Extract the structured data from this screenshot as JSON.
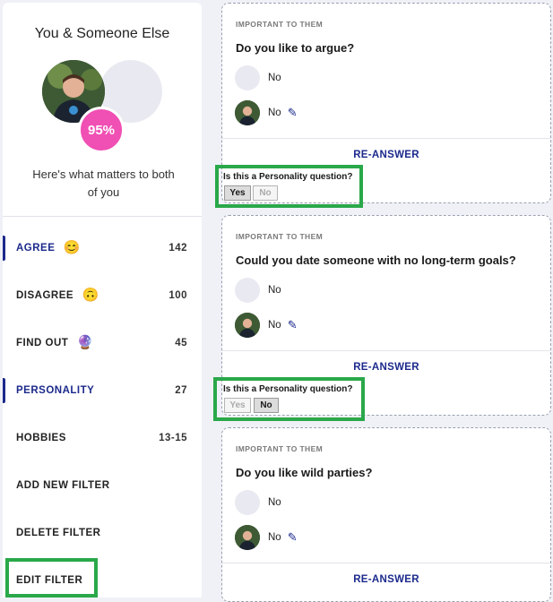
{
  "sidebar": {
    "title": "You & Someone Else",
    "match_percent": "95%",
    "subtitle": "Here's what matters to both of you",
    "filters": [
      {
        "label": "AGREE",
        "emoji": "😊",
        "count": "142",
        "active": true
      },
      {
        "label": "DISAGREE",
        "emoji": "🙃",
        "count": "100",
        "active": false
      },
      {
        "label": "FIND OUT",
        "emoji": "🔮",
        "count": "45",
        "active": false
      },
      {
        "label": "PERSONALITY",
        "emoji": "",
        "count": "27",
        "active": true
      },
      {
        "label": "HOBBIES",
        "emoji": "",
        "count": "13-15",
        "active": false
      },
      {
        "label": "ADD NEW FILTER",
        "emoji": "",
        "count": "",
        "active": false
      },
      {
        "label": "DELETE FILTER",
        "emoji": "",
        "count": "",
        "active": false
      },
      {
        "label": "EDIT FILTER",
        "emoji": "",
        "count": "",
        "active": false
      }
    ]
  },
  "cards": [
    {
      "tag": "IMPORTANT TO THEM",
      "question": "Do you like to argue?",
      "their_answer": "No",
      "your_answer": "No",
      "reanswer": "RE-ANSWER",
      "personality_prompt": "Is this a Personality question?",
      "yes": "Yes",
      "no": "No",
      "selected": "yes"
    },
    {
      "tag": "IMPORTANT TO THEM",
      "question": "Could you date someone with no long-term goals?",
      "their_answer": "No",
      "your_answer": "No",
      "reanswer": "RE-ANSWER",
      "personality_prompt": "Is this a Personality question?",
      "yes": "Yes",
      "no": "No",
      "selected": "no"
    },
    {
      "tag": "IMPORTANT TO THEM",
      "question": "Do you like wild parties?",
      "their_answer": "No",
      "your_answer": "No",
      "reanswer": "RE-ANSWER"
    }
  ],
  "colors": {
    "accent": "#1c2a8c",
    "match": "#f04fb4",
    "highlight": "#2aa84a"
  }
}
